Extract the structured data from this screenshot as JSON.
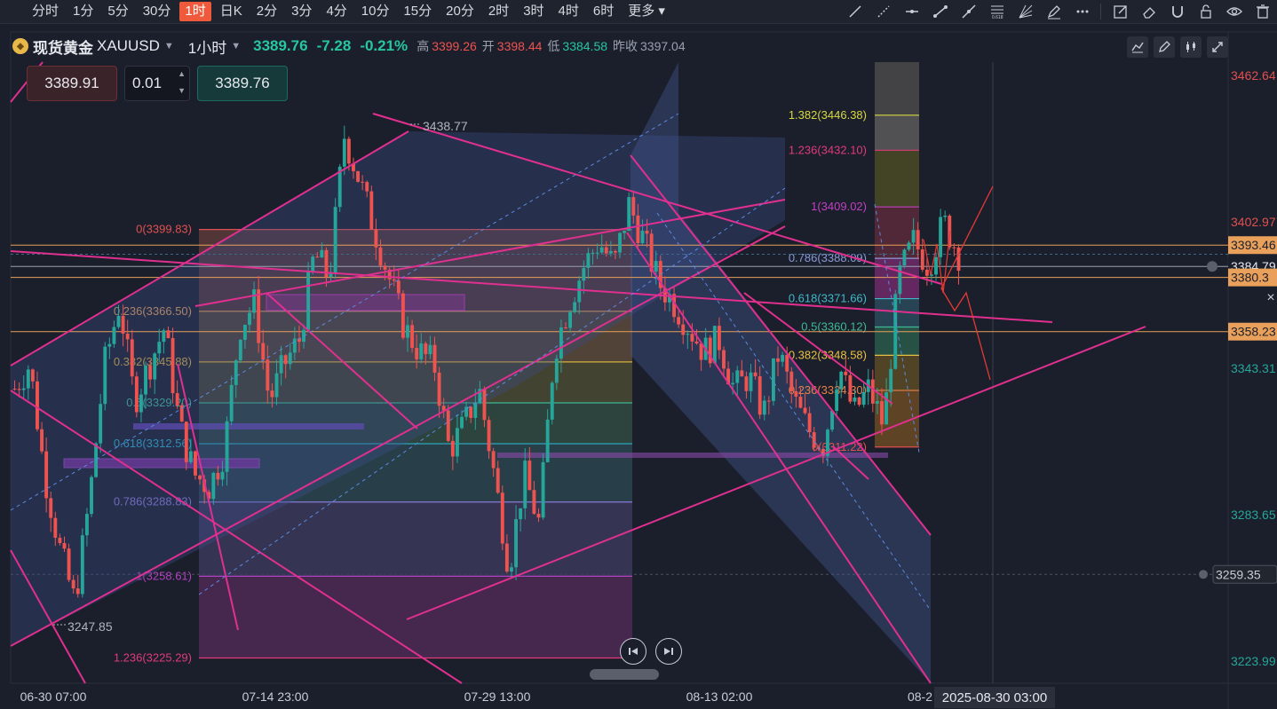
{
  "timeframes": [
    "分时",
    "1分",
    "5分",
    "30分",
    "1时",
    "日K",
    "2分",
    "3分",
    "4分",
    "10分",
    "15分",
    "20分",
    "2时",
    "3时",
    "4时",
    "6时",
    "更多"
  ],
  "active_timeframe": "1时",
  "header": {
    "symbol_name": "现货黄金",
    "symbol_code": "XAUUSD",
    "interval": "1小时",
    "last_price": "3389.76",
    "change": "-7.28",
    "change_pct": "-0.21%",
    "high_label": "高",
    "high": "3399.26",
    "open_label": "开",
    "open": "3398.44",
    "low_label": "低",
    "low": "3384.58",
    "prev_close_label": "昨收",
    "prev_close": "3397.04"
  },
  "order": {
    "sell_price": "3389.91",
    "lot": "0.01",
    "buy_price": "3389.76"
  },
  "colors": {
    "bg": "#1b1f2b",
    "up": "#26a69a",
    "down": "#ef5350",
    "magenta": "#e0308f",
    "orange": "#e8a05a",
    "fib_purple": "#9c27b0"
  },
  "icons": [
    "trend-line-icon",
    "ray-icon",
    "horizontal-line-icon",
    "segment-icon",
    "extended-line-icon",
    "fib-retracement-icon",
    "gann-fan-icon",
    "pen-icon",
    "more-icon",
    "edit-icon",
    "eraser-icon",
    "magnet-icon",
    "lock-icon",
    "eye-icon",
    "delete-icon"
  ],
  "chart_data": {
    "type": "candlestick",
    "ylim": [
      3215,
      3468
    ],
    "y_ticks": [
      "3462.64",
      "3402.97",
      "3343.31",
      "3283.65",
      "3223.99"
    ],
    "price_tags": [
      {
        "value": "3393.46",
        "style": "orange"
      },
      {
        "value": "3384.79",
        "style": "dark"
      },
      {
        "value": "3380.3",
        "style": "orange"
      },
      {
        "value": "3358.23",
        "style": "orange"
      },
      {
        "value": "3259.35",
        "style": "gray"
      }
    ],
    "x_ticks": [
      "06-30 07:00",
      "07-14 23:00",
      "07-29 13:00",
      "08-13 02:00",
      "08-2"
    ],
    "crosshair_time": "2025-08-30 03:00",
    "annotations": {
      "high": "3438.77",
      "low": "3247.85"
    },
    "fib_1": {
      "levels": [
        {
          "ratio": "0",
          "price": 3399.83,
          "text": "0(3399.83)"
        },
        {
          "ratio": "0.236",
          "price": 3366.5,
          "text": "0.236(3366.50)"
        },
        {
          "ratio": "0.382",
          "price": 3345.88,
          "text": "0.382(3345.88)"
        },
        {
          "ratio": "0.5",
          "price": 3329.2,
          "text": "0.5(3329.20)"
        },
        {
          "ratio": "0.618",
          "price": 3312.56,
          "text": "0.618(3312.56)"
        },
        {
          "ratio": "0.786",
          "price": 3288.83,
          "text": "0.786(3288.83)"
        },
        {
          "ratio": "1",
          "price": 3258.61,
          "text": "1(3258.61)"
        },
        {
          "ratio": "1.236",
          "price": 3225.29,
          "text": "1.236(3225.29)"
        }
      ]
    },
    "fib_2": {
      "levels": [
        {
          "ratio": "1.382",
          "price": 3446.38,
          "text": "1.382(3446.38)"
        },
        {
          "ratio": "1.236",
          "price": 3432.1,
          "text": "1.236(3432.10)"
        },
        {
          "ratio": "1",
          "price": 3409.02,
          "text": "1(3409.02)"
        },
        {
          "ratio": "0.786",
          "price": 3388.09,
          "text": "0.786(3388.09)"
        },
        {
          "ratio": "0.618",
          "price": 3371.66,
          "text": "0.618(3371.66)"
        },
        {
          "ratio": "0.5",
          "price": 3360.12,
          "text": "0.5(3360.12)"
        },
        {
          "ratio": "0.382",
          "price": 3348.58,
          "text": "0.382(3348.58)"
        },
        {
          "ratio": "0.236",
          "price": 3334.3,
          "text": "0.236(3334.30)"
        },
        {
          "ratio": "0",
          "price": 3311.22,
          "text": "0(3311.22)"
        }
      ]
    },
    "price_path": [
      3335,
      3345,
      3300,
      3270,
      3248,
      3290,
      3345,
      3370,
      3330,
      3345,
      3360,
      3320,
      3300,
      3295,
      3310,
      3360,
      3370,
      3330,
      3345,
      3355,
      3390,
      3380,
      3438,
      3420,
      3400,
      3380,
      3360,
      3350,
      3345,
      3310,
      3320,
      3335,
      3300,
      3262,
      3300,
      3280,
      3350,
      3370,
      3385,
      3395,
      3385,
      3410,
      3395,
      3378,
      3370,
      3360,
      3350,
      3355,
      3335,
      3340,
      3325,
      3350,
      3330,
      3318,
      3312,
      3345,
      3325,
      3335,
      3320,
      3380,
      3395,
      3385,
      3403,
      3390
    ]
  }
}
